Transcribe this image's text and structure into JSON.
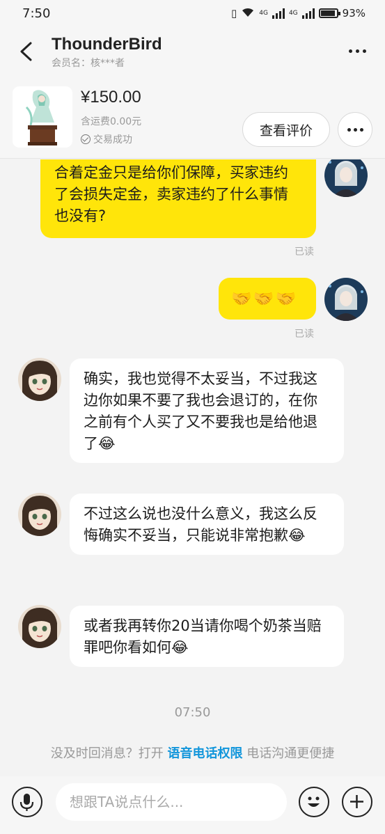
{
  "status": {
    "time": "7:50",
    "network1": "4G",
    "network2": "4G",
    "battery": "93%"
  },
  "header": {
    "title": "ThounderBird",
    "subtitle": "会员名：核***者"
  },
  "product": {
    "price": "¥150.00",
    "shipping": "含运费0.00元",
    "status": "交易成功",
    "review_label": "查看评价"
  },
  "messages": [
    {
      "side": "mine",
      "text": "合着定金只是给你们保障，买家违约了会损失定金，卖家违约了什么事情也没有?",
      "read": "已读"
    },
    {
      "side": "mine",
      "text": "🤝🤝🤝",
      "read": "已读"
    },
    {
      "side": "theirs",
      "text": "确实，我也觉得不太妥当，不过我这边你如果不要了我也会退订的，在你之前有个人买了又不要我也是给他退了😂"
    },
    {
      "side": "theirs",
      "text": "不过这么说也没什么意义，我这么反悔确实不妥当，只能说非常抱歉😂"
    },
    {
      "side": "theirs",
      "text": "或者我再转你20当请你喝个奶茶当赔罪吧你看如何😂"
    }
  ],
  "chat_time": "07:50",
  "notice": {
    "before": "没及时回消息？打开 ",
    "link": "语音电话权限",
    "after": " 电话沟通更便捷"
  },
  "input": {
    "placeholder": "想跟TA说点什么..."
  },
  "icons": [
    "back-icon",
    "more-icon",
    "check-circle-icon",
    "microphone-icon",
    "emoji-icon",
    "plus-icon"
  ],
  "colors": {
    "mine_bubble": "#ffe50a",
    "theirs_bubble": "#ffffff",
    "link": "#1296db",
    "background": "#f3f3f3"
  }
}
